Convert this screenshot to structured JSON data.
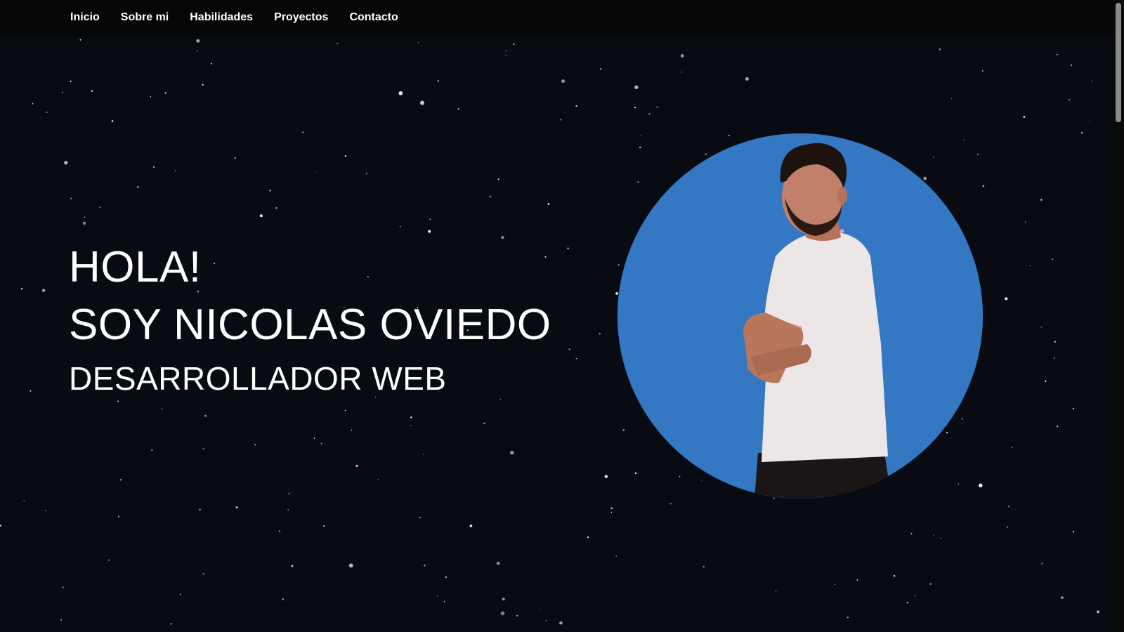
{
  "nav": {
    "items": [
      {
        "label": "Inicio"
      },
      {
        "label": "Sobre mi"
      },
      {
        "label": "Habilidades"
      },
      {
        "label": "Proyectos"
      },
      {
        "label": "Contacto"
      }
    ]
  },
  "hero": {
    "greeting": "HOLA!",
    "name_line": "SOY NICOLAS OVIEDO",
    "role": "DESARROLLADOR WEB"
  },
  "portrait": {
    "icon": "person-photo",
    "background_color": "#3478c4"
  },
  "theme": {
    "background": "#080b12",
    "nav_background": "#050608",
    "text": "#ffffff"
  }
}
